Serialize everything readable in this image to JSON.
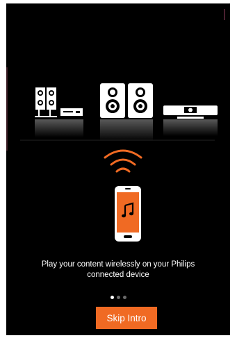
{
  "onboarding": {
    "caption_line1": "Play your content wirelessly on your Philips",
    "caption_line2": "connected device",
    "page_indicator": {
      "current": 1,
      "total": 3
    },
    "skip_label": "Skip Intro"
  },
  "icons": {
    "devices": [
      "hifi-system-icon",
      "bookshelf-speakers-icon",
      "soundbar-icon"
    ],
    "signal": "wifi-signal-icon",
    "phone": "smartphone-music-icon"
  },
  "colors": {
    "background": "#000000",
    "accent": "#f06a23",
    "text": "#ffffff",
    "dot_inactive": "#6a6a6a"
  }
}
